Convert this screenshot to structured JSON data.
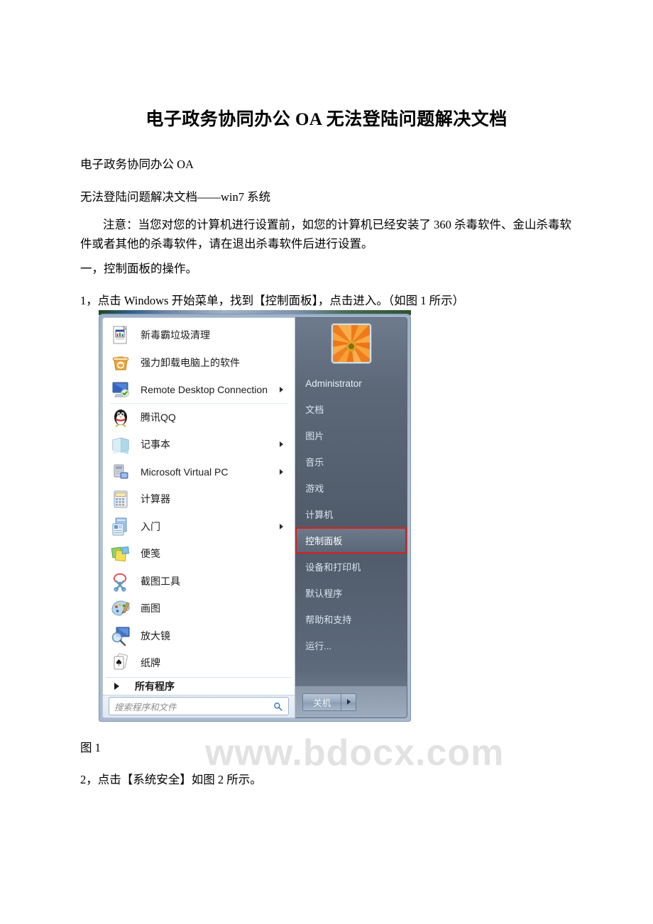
{
  "document": {
    "title": "电子政务协同办公 OA 无法登陆问题解决文档",
    "line1": "电子政务协同办公 OA",
    "line2": "无法登陆问题解决文档——win7 系统",
    "note": "注意：当您对您的计算机进行设置前，如您的计算机已经安装了 360 杀毒软件、金山杀毒软件或者其他的杀毒软件，请在退出杀毒软件后进行设置。",
    "section1": "一，控制面板的操作。",
    "step1": "1，点击 Windows 开始菜单，找到【控制面板】，点击进入。（如图 1 所示）",
    "figure1_caption": "图 1",
    "step2": "2，点击【系统安全】如图 2 所示。"
  },
  "watermark": "www.bdocx.com",
  "start_menu": {
    "programs": [
      {
        "label": "新毒霸垃圾清理",
        "icon": "document-icon",
        "arrow": false,
        "separator": false
      },
      {
        "label": "强力卸载电脑上的软件",
        "icon": "recycle-bin-icon",
        "arrow": false,
        "separator": false
      },
      {
        "label": "Remote Desktop Connection",
        "icon": "remote-desktop-icon",
        "arrow": true,
        "separator": true
      },
      {
        "label": "腾讯QQ",
        "icon": "qq-penguin-icon",
        "arrow": false,
        "separator": false
      },
      {
        "label": "记事本",
        "icon": "notepad-icon",
        "arrow": true,
        "separator": false
      },
      {
        "label": "Microsoft Virtual PC",
        "icon": "virtual-pc-icon",
        "arrow": true,
        "separator": false
      },
      {
        "label": "计算器",
        "icon": "calculator-icon",
        "arrow": false,
        "separator": false
      },
      {
        "label": "入门",
        "icon": "getting-started-icon",
        "arrow": true,
        "separator": false
      },
      {
        "label": "便笺",
        "icon": "sticky-notes-icon",
        "arrow": false,
        "separator": false
      },
      {
        "label": "截图工具",
        "icon": "snipping-tool-icon",
        "arrow": false,
        "separator": false
      },
      {
        "label": "画图",
        "icon": "paint-icon",
        "arrow": false,
        "separator": false
      },
      {
        "label": "放大镜",
        "icon": "magnifier-icon",
        "arrow": false,
        "separator": false
      },
      {
        "label": "纸牌",
        "icon": "solitaire-icon",
        "arrow": false,
        "separator": false
      }
    ],
    "all_programs_label": "所有程序",
    "search_placeholder": "搜索程序和文件",
    "user_name": "Administrator",
    "right_items": [
      {
        "label": "文档",
        "highlighted": false
      },
      {
        "label": "图片",
        "highlighted": false
      },
      {
        "label": "音乐",
        "highlighted": false
      },
      {
        "label": "游戏",
        "highlighted": false
      },
      {
        "label": "计算机",
        "highlighted": false
      },
      {
        "label": "控制面板",
        "highlighted": true
      },
      {
        "label": "设备和打印机",
        "highlighted": false
      },
      {
        "label": "默认程序",
        "highlighted": false
      },
      {
        "label": "帮助和支持",
        "highlighted": false
      },
      {
        "label": "运行...",
        "highlighted": false
      }
    ],
    "shutdown_label": "关机",
    "highlight_color": "#e01b1b"
  }
}
